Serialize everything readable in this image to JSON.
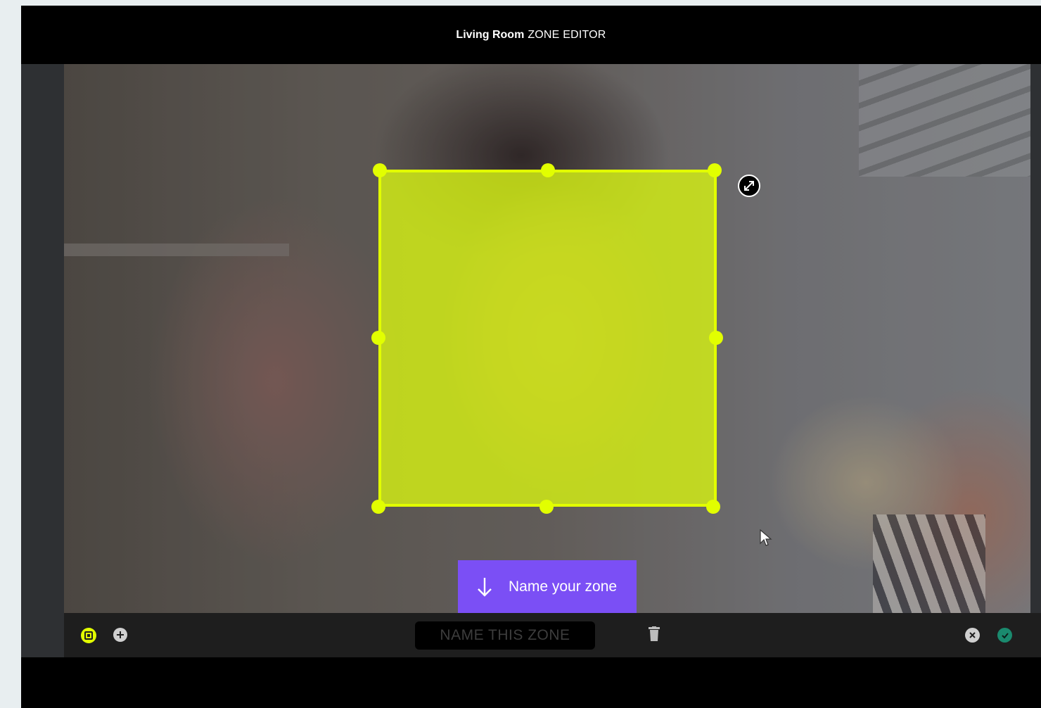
{
  "header": {
    "room_name": "Living Room",
    "editor_label": "ZONE EDITOR"
  },
  "tooltip": {
    "text": "Name your zone",
    "icon": "arrow-down-icon"
  },
  "zone": {
    "name_placeholder": "NAME THIS ZONE",
    "fill_color": "#d4f014",
    "border_color": "#e2ff00"
  },
  "toolbar": {
    "left_icons": [
      "zone-select-icon",
      "add-zone-icon"
    ],
    "center_icons": [
      "trash-icon"
    ],
    "right_icons": [
      "cancel-icon",
      "confirm-icon"
    ]
  },
  "colors": {
    "accent": "#e2ff00",
    "tooltip": "#7b4ff5",
    "confirm": "#1a8a6e"
  }
}
